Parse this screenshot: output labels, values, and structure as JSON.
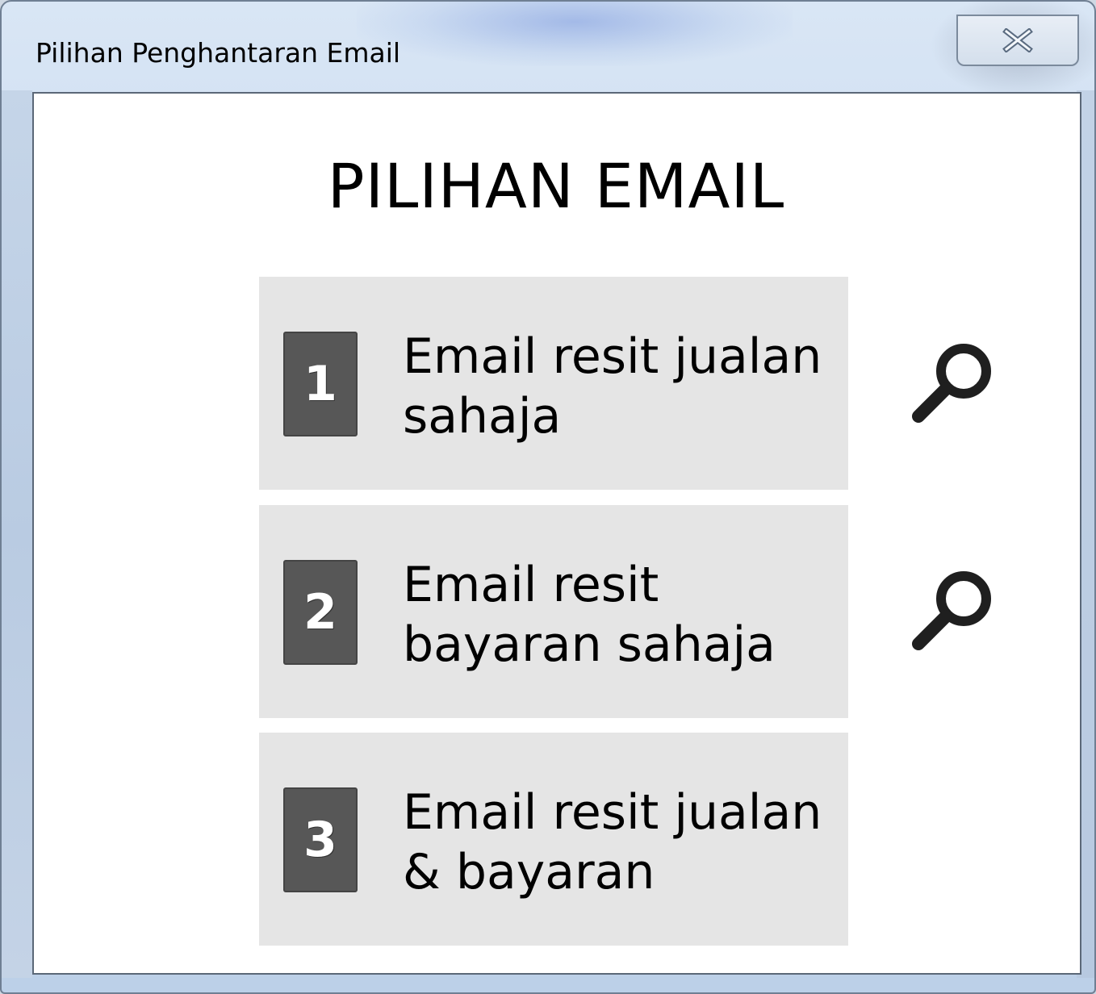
{
  "window": {
    "title": "Pilihan Penghantaran Email"
  },
  "dialog": {
    "heading": "PILIHAN EMAIL",
    "options": [
      {
        "number": "1",
        "label": "Email resit jualan sahaja",
        "has_preview": true
      },
      {
        "number": "2",
        "label": "Email resit bayaran sahaja",
        "has_preview": true
      },
      {
        "number": "3",
        "label": "Email resit jualan & bayaran",
        "has_preview": false
      }
    ]
  },
  "icons": {
    "close": "close-icon",
    "preview": "magnifier-icon"
  },
  "colors": {
    "option_bg": "#e5e5e5",
    "number_box_bg": "#575757",
    "client_bg": "#ffffff"
  }
}
